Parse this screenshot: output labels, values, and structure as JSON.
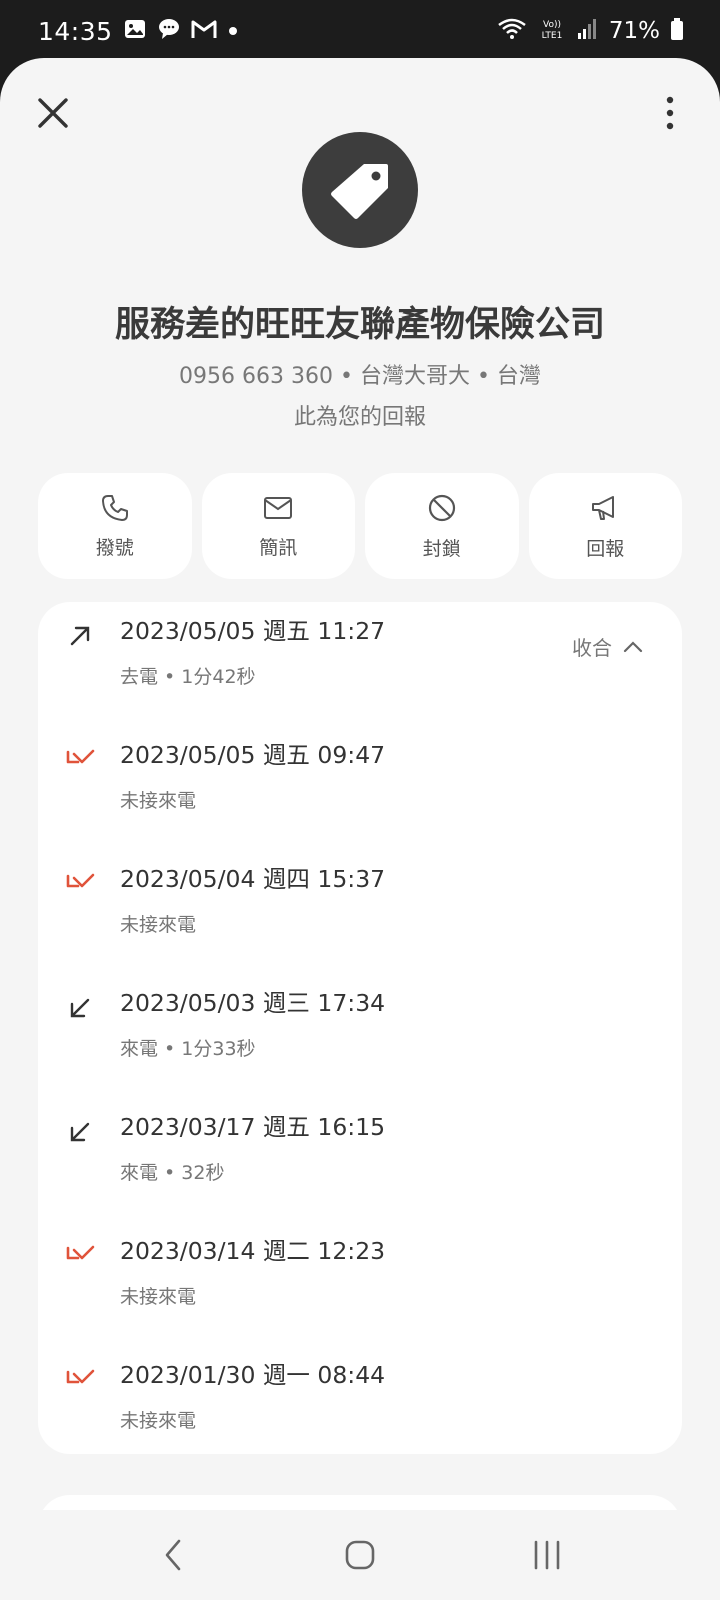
{
  "status_bar": {
    "time": "14:35",
    "battery": "71%",
    "icons": [
      "gallery-icon",
      "chat-icon",
      "gmail-icon",
      "dot-icon",
      "wifi-icon",
      "volte-icon",
      "signal-icon",
      "battery-icon"
    ]
  },
  "contact": {
    "name": "服務差的旺旺友聯產物保險公司",
    "info": "0956 663 360 • 台灣大哥大 • 台灣",
    "note": "此為您的回報",
    "avatar_icon": "tag-icon"
  },
  "actions": [
    {
      "label": "撥號",
      "icon": "phone-icon"
    },
    {
      "label": "簡訊",
      "icon": "message-icon"
    },
    {
      "label": "封鎖",
      "icon": "block-icon"
    },
    {
      "label": "回報",
      "icon": "report-icon"
    }
  ],
  "collapse_label": "收合",
  "call_log": [
    {
      "date": "2023/05/05 週五 11:27",
      "detail": "去電 • 1分42秒",
      "type": "outgoing"
    },
    {
      "date": "2023/05/05 週五 09:47",
      "detail": "未接來電",
      "type": "missed"
    },
    {
      "date": "2023/05/04 週四 15:37",
      "detail": "未接來電",
      "type": "missed"
    },
    {
      "date": "2023/05/03 週三 17:34",
      "detail": "來電 • 1分33秒",
      "type": "incoming"
    },
    {
      "date": "2023/03/17 週五 16:15",
      "detail": "來電 • 32秒",
      "type": "incoming"
    },
    {
      "date": "2023/03/14 週二 12:23",
      "detail": "未接來電",
      "type": "missed"
    },
    {
      "date": "2023/01/30 週一 08:44",
      "detail": "未接來電",
      "type": "missed"
    }
  ],
  "colors": {
    "missed": "#e0533a",
    "normal_arrow": "#333333",
    "sheet_bg": "#f5f5f5",
    "card_bg": "#ffffff"
  },
  "nav": [
    "back-icon",
    "home-icon",
    "recents-icon"
  ]
}
